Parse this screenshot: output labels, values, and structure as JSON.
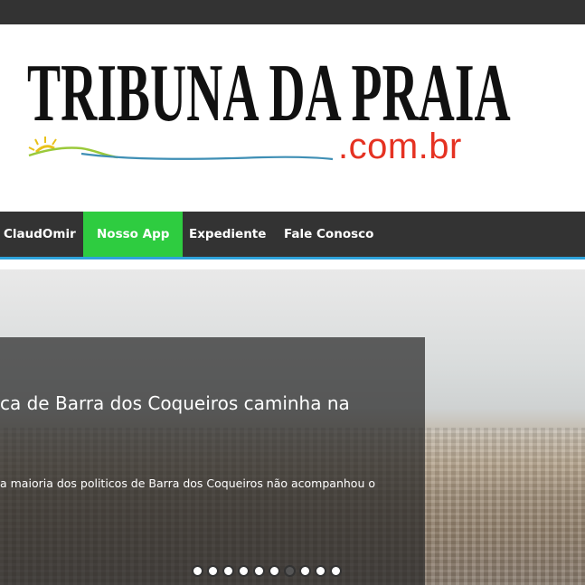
{
  "site": {
    "logo_title": "TRIBUNA DA PRAIA",
    "logo_subtitle": ".com.br"
  },
  "nav": {
    "items": [
      {
        "label": "ClaudOmir",
        "active": false
      },
      {
        "label": "Nosso App",
        "active": true
      },
      {
        "label": "Expediente",
        "active": false
      },
      {
        "label": "Fale Conosco",
        "active": false
      }
    ]
  },
  "slider": {
    "title": "ca de Barra dos Coqueiros caminha na",
    "excerpt": "a maioria dos politicos de Barra dos Coqueiros não acompanhou o",
    "total_slides": 10,
    "current_slide": 7
  },
  "colors": {
    "topbar": "#333333",
    "nav_background": "#333333",
    "nav_active": "#2ecc40",
    "nav_underline": "#2ea3dc",
    "logo_subtitle": "#e53222"
  }
}
